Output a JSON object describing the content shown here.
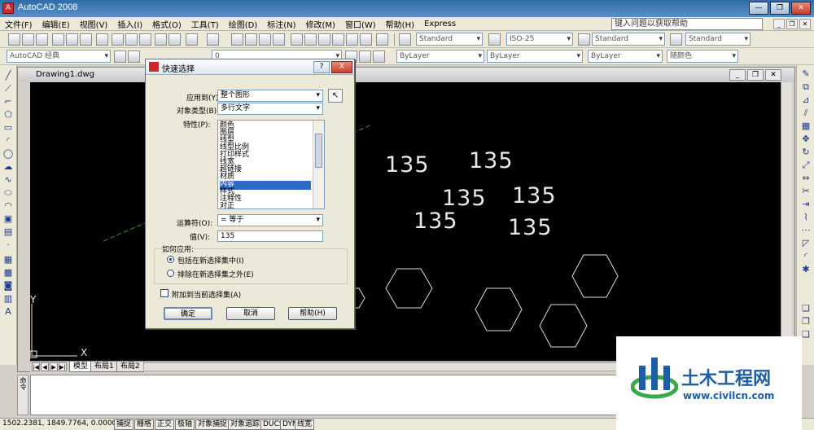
{
  "window": {
    "title": "AutoCAD 2008"
  },
  "menu": {
    "items": [
      "文件(F)",
      "编辑(E)",
      "视图(V)",
      "插入(I)",
      "格式(O)",
      "工具(T)",
      "绘图(D)",
      "标注(N)",
      "修改(M)",
      "窗口(W)",
      "帮助(H)",
      "Express"
    ],
    "help_search_placeholder": "键入问题以获取帮助"
  },
  "toolbar": {
    "text_style": "Standard",
    "dim_style": "ISO-25",
    "table_style": "Standard",
    "multileader_style": "Standard",
    "workspace": "AutoCAD 经典",
    "layer": "0",
    "color": "ByLayer",
    "linetype": "ByLayer",
    "lineweight": "ByLayer",
    "plot_style": "随颜色"
  },
  "drawing": {
    "tab_title": "Drawing1.dwg",
    "canvas_text": "135",
    "ucs_x": "X",
    "ucs_y": "Y",
    "sheet_tabs": [
      "模型",
      "布局1",
      "布局2"
    ]
  },
  "dialog": {
    "title": "快速选择",
    "help_glyph": "?",
    "close_glyph": "X",
    "apply_to_label": "应用到(Y):",
    "apply_to_value": "整个图形",
    "object_type_label": "对象类型(B):",
    "object_type_value": "多行文字",
    "properties_label": "特性(P):",
    "properties": [
      "颜色",
      "图层",
      "线型",
      "线型比例",
      "打印样式",
      "线宽",
      "超链接",
      "材质",
      "内容",
      "样式",
      "注释性",
      "对正"
    ],
    "selected_property_index": 8,
    "operator_label": "运算符(O):",
    "operator_value": "= 等于",
    "value_label": "值(V):",
    "value_value": "135",
    "how_to_apply_label": "如何应用:",
    "include_option": "包括在新选择集中(I)",
    "exclude_option": "排除在新选择集之外(E)",
    "append_option": "附加到当前选择集(A)",
    "ok_label": "确定",
    "cancel_label": "取消",
    "help_label": "帮助(H)"
  },
  "command": {
    "side_label": "命令"
  },
  "status": {
    "coordinates": "1502.2381, 1849.7764, 0.0000",
    "toggles": [
      "捕捉",
      "栅格",
      "正交",
      "极轴",
      "对象捕捉",
      "对象追踪",
      "DUCS",
      "DYN",
      "线宽"
    ]
  },
  "watermark": {
    "name": "土木工程网",
    "url": "www.civilcn.com"
  },
  "colors": {
    "canvas": "#000000",
    "selection": "#316ac5",
    "watermark_blue": "#1d5ea6",
    "watermark_green": "#3aa84b"
  }
}
